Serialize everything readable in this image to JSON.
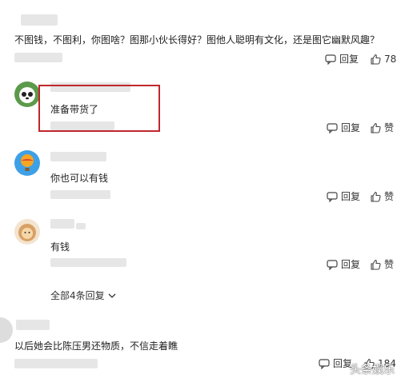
{
  "top_comment": {
    "text": "不图钱，不图利，你图啥？图那小伙长得好？图他人聪明有文化，还是图它幽默风趣？",
    "reply_label": "回复",
    "like_label": "78"
  },
  "replies": [
    {
      "text": "准备带货了",
      "reply_label": "回复",
      "like_label": "赞"
    },
    {
      "text": "你也可以有钱",
      "reply_label": "回复",
      "like_label": "赞"
    },
    {
      "text": "有钱",
      "reply_label": "回复",
      "like_label": "赞"
    }
  ],
  "expand_label": "全部4条回复",
  "bottom_comment": {
    "text": "以后她会比陈压男还物质，不信走着瞧",
    "reply_label": "回复",
    "like_label": "184"
  },
  "watermark": "头条娱乐",
  "colors": {
    "highlight": "#c0262d"
  }
}
